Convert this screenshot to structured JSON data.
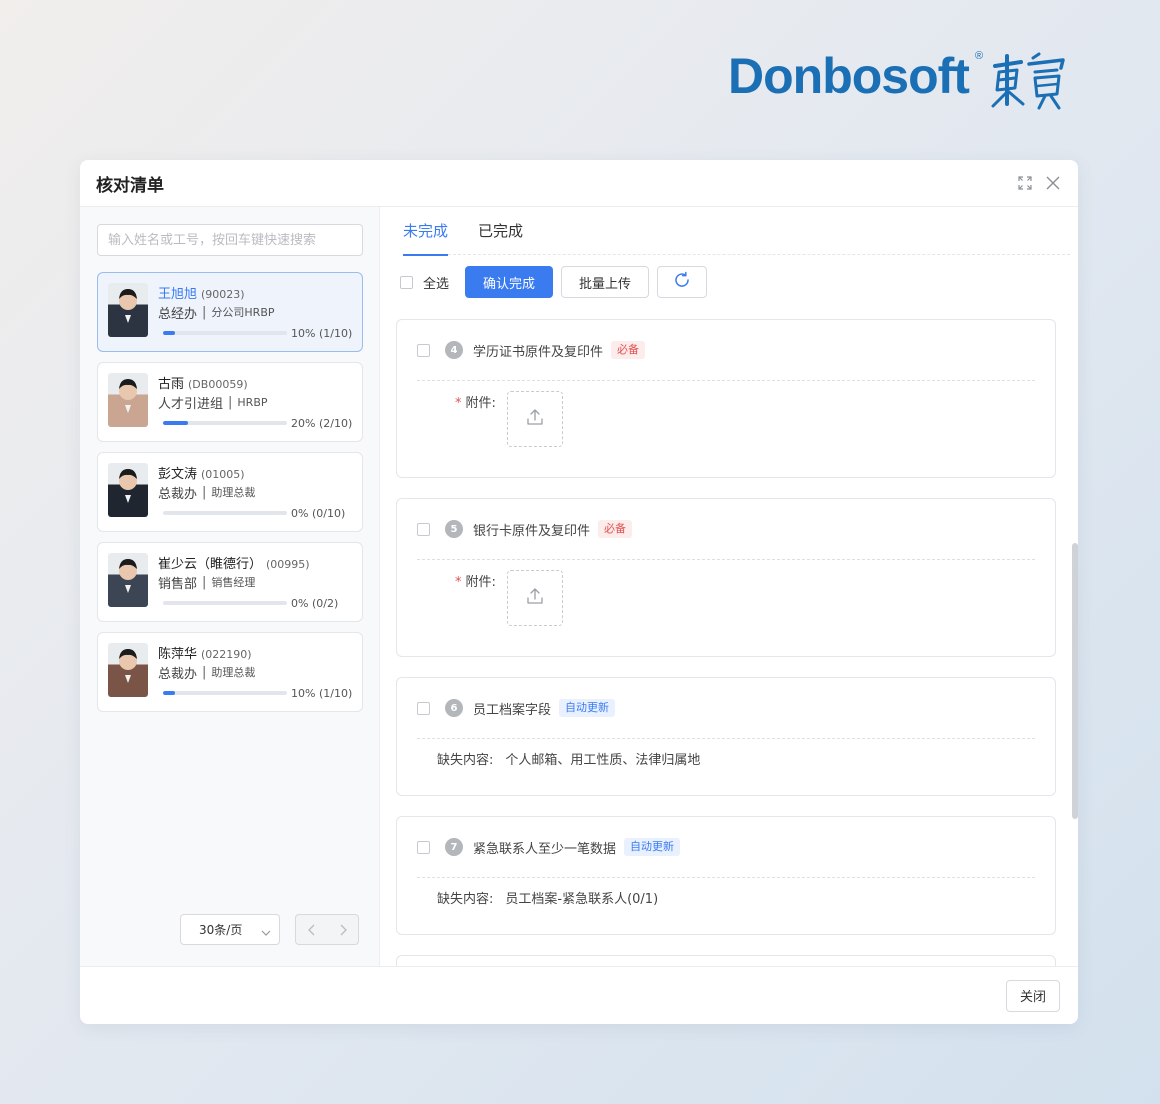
{
  "brand": {
    "name": "Donbosoft",
    "registered": "®",
    "chinese_logo": "東寶"
  },
  "dialog": {
    "title": "核对清单",
    "close_label": "关闭"
  },
  "search": {
    "placeholder": "输入姓名或工号，按回车键快速搜索"
  },
  "employees": [
    {
      "name": "王旭旭",
      "id": "(90023)",
      "dept": "总经办",
      "role": "分公司HRBP",
      "progress": 0.1,
      "progress_text": "10% (1/10)",
      "active": true,
      "avatar_color": "#2b3440"
    },
    {
      "name": "古雨",
      "id": "(DB00059)",
      "dept": "人才引进组",
      "role": "HRBP",
      "progress": 0.2,
      "progress_text": "20% (2/10)",
      "active": false,
      "avatar_color": "#c9a592"
    },
    {
      "name": "彭文涛",
      "id": "(01005)",
      "dept": "总裁办",
      "role": "助理总裁",
      "progress": 0,
      "progress_text": "0% (0/10)",
      "active": false,
      "avatar_color": "#1f2630"
    },
    {
      "name": "崔少云（睢德行）",
      "id": "(00995)",
      "dept": "销售部",
      "role": "销售经理",
      "progress": 0,
      "progress_text": "0% (0/2)",
      "active": false,
      "avatar_color": "#3b4553"
    },
    {
      "name": "陈萍华",
      "id": "(022190)",
      "dept": "总裁办",
      "role": "助理总裁",
      "progress": 0.1,
      "progress_text": "10% (1/10)",
      "active": false,
      "avatar_color": "#7a5446"
    }
  ],
  "pager": {
    "page_size": "30条/页"
  },
  "tabs": [
    {
      "label": "未完成",
      "active": true
    },
    {
      "label": "已完成",
      "active": false
    }
  ],
  "toolbar": {
    "select_all": "全选",
    "confirm": "确认完成",
    "batch_upload": "批量上传"
  },
  "items": [
    {
      "num": "4",
      "title": "学历证书原件及复印件",
      "tag": "必备",
      "tag_type": "required",
      "attach_label": "附件:"
    },
    {
      "num": "5",
      "title": "银行卡原件及复印件",
      "tag": "必备",
      "tag_type": "required",
      "attach_label": "附件:"
    },
    {
      "num": "6",
      "title": "员工档案字段",
      "tag": "自动更新",
      "tag_type": "auto",
      "missing_label": "缺失内容:",
      "missing_value": "个人邮箱、用工性质、法律归属地"
    },
    {
      "num": "7",
      "title": "紧急联系人至少一笔数据",
      "tag": "自动更新",
      "tag_type": "auto",
      "missing_label": "缺失内容:",
      "missing_value": "员工档案-紧急联系人(0/1)"
    }
  ],
  "colors": {
    "accent": "#3a7bf0",
    "required_tag": "#e25252",
    "brand": "#1a6fb5"
  }
}
